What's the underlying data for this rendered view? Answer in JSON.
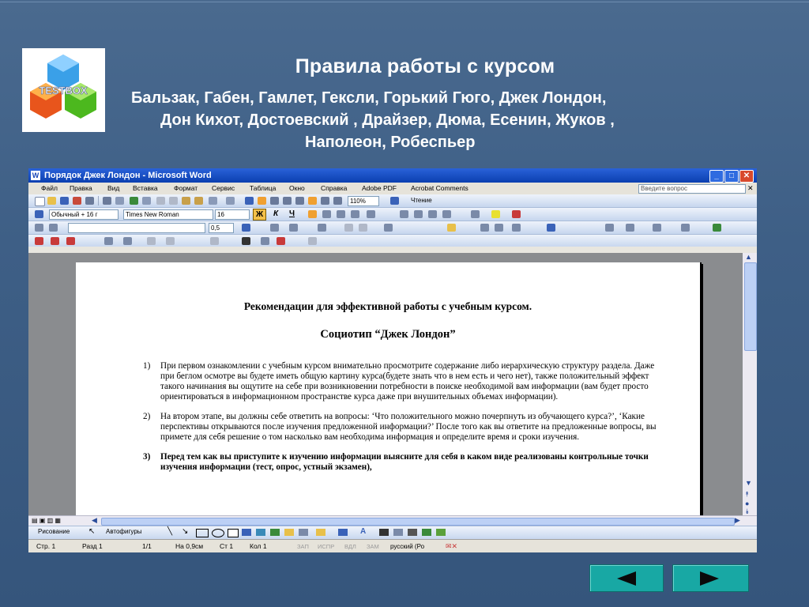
{
  "slide": {
    "title": "Правила работы с курсом",
    "subtitle_lines": [
      "Бальзак, Габен, Гамлет, Гексли, Горький Гюго, Джек Лондон,",
      "Дон Кихот, Достоевский , Драйзер, Дюма, Есенин, Жуков ,",
      "Наполеон, Робеспьер"
    ],
    "logo_text": "TESTBOX"
  },
  "window": {
    "title": "Порядок Джек Лондон - Microsoft Word",
    "menu": [
      "Файл",
      "Правка",
      "Вид",
      "Вставка",
      "Формат",
      "Сервис",
      "Таблица",
      "Окно",
      "Справка",
      "Adobe PDF",
      "Acrobat Comments"
    ],
    "ask_placeholder": "Введите вопрос",
    "toolbar": {
      "zoom": "110%",
      "read_label": "Чтение",
      "style": "Обычный + 16 г",
      "font": "Times New Roman",
      "size": "16",
      "bold": "Ж",
      "italic": "К",
      "underline": "Ч",
      "line_width": "0,5"
    },
    "drawing": {
      "draw_label": "Рисование",
      "autoshapes_label": "Автофигуры"
    },
    "status": {
      "page": "Стр. 1",
      "section": "Разд 1",
      "pages": "1/1",
      "at": "На 0,9см",
      "line": "Ст 1",
      "col": "Кол 1",
      "rec": "ЗАП",
      "trk": "ИСПР",
      "ext": "ВДЛ",
      "ovr": "ЗАМ",
      "lang": "русский (Ро"
    }
  },
  "document": {
    "heading": "Рекомендации для эффективной работы с учебным курсом.",
    "subheading": "Социотип “Джек Лондон”",
    "items": [
      {
        "num": "1)",
        "text": "При первом ознакомлении с учебным курсом внимательно просмотрите содержание либо иерархическую структуру раздела. Даже при беглом осмотре вы будете иметь общую картину курса(будете знать что в нем есть и чего нет), также положительный эффект такого начинания вы ощутите на себе при возникновении потребности в поиске необходимой вам информации (вам будет просто ориентироваться в информационном пространстве курса даже при внушительных объемах информации)."
      },
      {
        "num": "2)",
        "text": "На втором этапе, вы должны себе ответить на вопросы: ‘Что положительного можно почерпнуть из обучающего курса?’, ‘Какие перспективы открываются после изучения предложенной информации?’ После того как вы ответите на предложенные вопросы, вы примете для себя решение о том насколько вам необходима информация и определите время и сроки изучения."
      },
      {
        "num": "3)",
        "text": "Перед тем как вы приступите к изучению информации выясните для себя в каком виде реализованы контрольные точки изучения информации (тест, опрос, устный экзамен),"
      }
    ]
  },
  "colors": {
    "background": "#3e5f86",
    "nav_button": "#18a8a4",
    "title_bar": "#0b3fb0"
  }
}
